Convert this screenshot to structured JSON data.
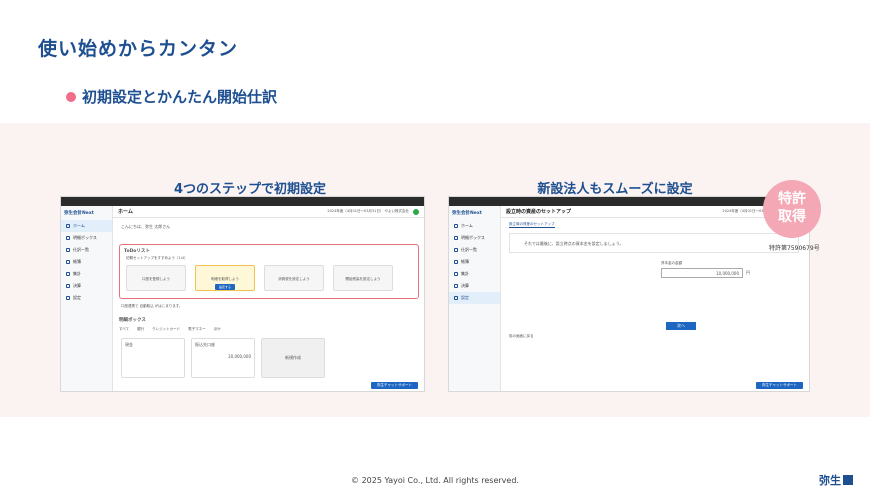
{
  "page": {
    "title": "使い始めからカンタン",
    "subtitle": "初期設定とかんたん開始仕訳",
    "footer": "© 2025 Yayoi Co., Ltd.  All rights reserved.",
    "brand": "弥生"
  },
  "left": {
    "caption": "4つのステップで初期設定",
    "app_logo": "弥生会計Next",
    "header": "ホーム",
    "header_meta": "2024年度（4月01日〜03月31日）  やよい株式会社",
    "sidebar": [
      "ホーム",
      "明細ボックス",
      "仕訳一覧",
      "帳簿",
      "集計",
      "決算",
      "設定"
    ],
    "greeting": "こんにちは、弥生 太郎さん",
    "todo_title": "ToDoリスト",
    "todo_sub": "初期セットアップをすすめよう（1/4）",
    "steps": [
      "口座を登録しよう",
      "明細を取得しよう",
      "消費税を設定しよう",
      "開始残高を設定しよう"
    ],
    "step_button": "設定する",
    "notice": "口座連携で 自動取込 がはじまります。",
    "detail_title": "明細ボックス",
    "tabs": [
      "すべて",
      "銀行",
      "クレジットカード",
      "電子マネー",
      "ほか"
    ],
    "card1": "現金",
    "card2_title": "振込先口座",
    "card2_amount": "20,000,000",
    "card3": "新規作成",
    "chat": "弥生チャットサポート"
  },
  "right": {
    "caption": "新設法人もスムーズに設定",
    "header": "設立時の資産のセットアップ",
    "header_meta": "2024年度（4月01日〜03月31日）  やよい株式会社",
    "tab": "設立時の資産のセットアップ",
    "message": "それでは最後に、設立時点の資本金を設定しましょう。",
    "input_label": "資本金の金額",
    "input_value": "10,000,000",
    "unit": "円",
    "next_button": "次へ",
    "back_link": "前の画面に戻る",
    "badge": [
      "特許",
      "取得"
    ],
    "patent": "特許第7590679号",
    "chat": "弥生チャットサポート"
  },
  "colors": {
    "accent": "#1d4f91",
    "pink": "#f06e8a",
    "band": "#fbf3f2"
  }
}
